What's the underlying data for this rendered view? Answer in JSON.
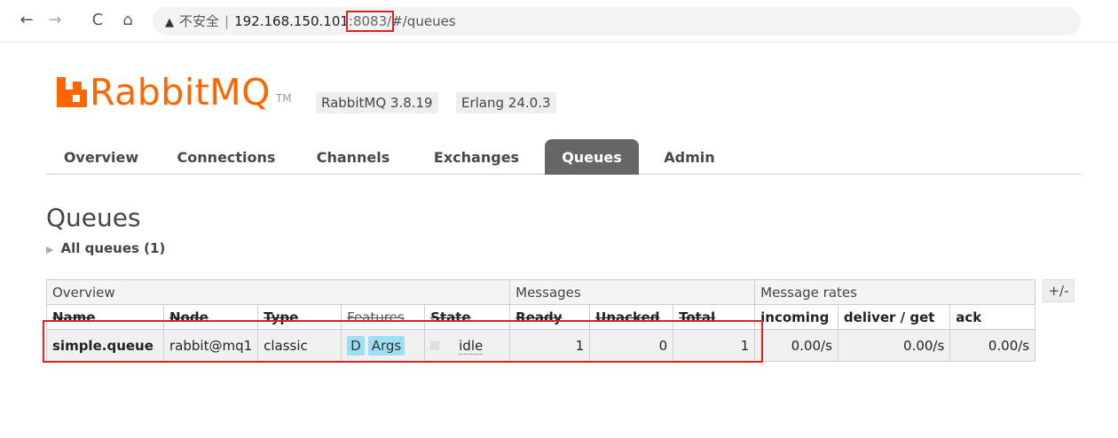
{
  "browser": {
    "back_icon": "←",
    "forward_icon": "→",
    "reload_icon": "C",
    "home_icon": "⌂",
    "warning_icon": "▲",
    "insecure_label": "不安全",
    "separator": "|",
    "host": "192.168.150.101",
    "port": ":8083/",
    "path": "#/queues"
  },
  "logo": {
    "text": "RabbitMQ",
    "tm": "TM"
  },
  "versions": {
    "rabbitmq": "RabbitMQ 3.8.19",
    "erlang": "Erlang 24.0.3"
  },
  "tabs": [
    "Overview",
    "Connections",
    "Channels",
    "Exchanges",
    "Queues",
    "Admin"
  ],
  "active_tab": "Queues",
  "page_title": "Queues",
  "all_queues_label": "All queues (1)",
  "table": {
    "groups": {
      "overview": "Overview",
      "messages": "Messages",
      "rates": "Message rates"
    },
    "headers": {
      "name": "Name",
      "node": "Node",
      "type": "Type",
      "features": "Features",
      "state": "State",
      "ready": "Ready",
      "unacked": "Unacked",
      "total": "Total",
      "incoming": "incoming",
      "deliver": "deliver / get",
      "ack": "ack"
    },
    "rows": [
      {
        "name": "simple.queue",
        "node": "rabbit@mq1",
        "type": "classic",
        "features": [
          "D",
          "Args"
        ],
        "state": "idle",
        "ready": "1",
        "unacked": "0",
        "total": "1",
        "incoming": "0.00/s",
        "deliver": "0.00/s",
        "ack": "0.00/s"
      }
    ],
    "columns_toggle": "+/-"
  },
  "colors": {
    "brand": "#ff6600",
    "highlight": "#e02020",
    "badge": "#9ddff4"
  }
}
